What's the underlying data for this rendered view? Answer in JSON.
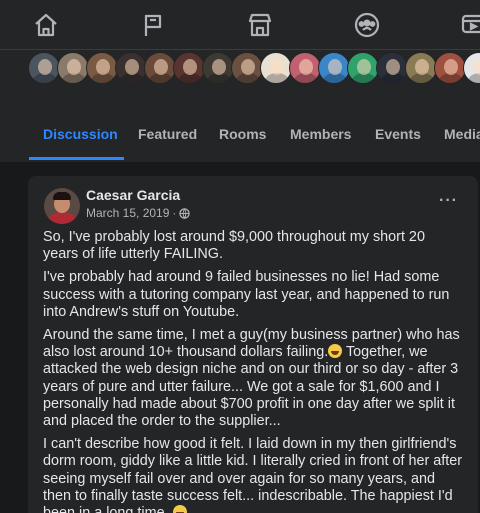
{
  "topnav": {
    "icons": [
      "home-icon",
      "flag-icon",
      "marketplace-icon",
      "groups-icon",
      "watch-icon"
    ]
  },
  "group": {
    "member_avatar_colors": [
      "#4a5560",
      "#8a7a6a",
      "#7a5a45",
      "#3a3030",
      "#6a4a3a",
      "#5a3530",
      "#3d3a33",
      "#6a5040",
      "#e8e0d0",
      "#c06070",
      "#3a86c9",
      "#2fa36b",
      "#2a2f3a",
      "#8a7a55",
      "#a05040",
      "#e6e6e6",
      "#e6e6e6"
    ],
    "tabs": [
      "Discussion",
      "Featured",
      "Rooms",
      "Members",
      "Events",
      "Media"
    ],
    "active_tab": "Discussion",
    "accent_color": "#2d88ff"
  },
  "post": {
    "author": "Caesar Garcia",
    "date": "March 15, 2019",
    "date_separator": "·",
    "privacy_icon": "globe-icon",
    "more_label": "···",
    "paragraphs": [
      "So, I've probably lost around $9,000 throughout my short 20 years of life utterly FAILING.",
      "I've probably had around 9 failed businesses no lie! Had some success with a tutoring company last year, and happened to run into Andrew's stuff on Youtube."
    ],
    "p3_before_emoji": "Around the same time, I met a guy(my business partner) who has also lost around 10+ thousand dollars failing.",
    "p3_after_emoji": " Together, we attacked the web design niche and on our third or so day - after 3 years of pure and utter failure... We got a sale for $1,600 and I personally had made about $700 profit in one day after we split it and placed the order to the supplier...",
    "p4_before_emoji": "I can't describe how good it felt. I laid down in my then girlfriend's dorm room, giddy like a little kid. I literally cried in front of her after seeing myself fail over and over again for so many years, and then to finally taste success felt... indescribable. The happiest I'd been in a long time. "
  }
}
